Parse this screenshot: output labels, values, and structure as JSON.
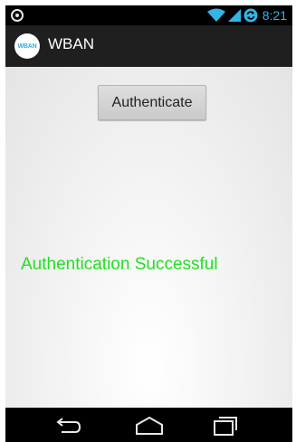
{
  "status_bar": {
    "time": "8:21",
    "icons": [
      "app-notification-icon",
      "wifi-icon",
      "signal-icon",
      "sync-icon"
    ],
    "accent_color": "#33b5e5"
  },
  "action_bar": {
    "logo_text": "WBAN",
    "title": "WBAN"
  },
  "main": {
    "authenticate_label": "Authenticate",
    "status_message": "Authentication Successful",
    "status_color": "#22e022"
  },
  "nav_bar": {
    "icons": [
      "back-icon",
      "home-icon",
      "recent-apps-icon"
    ]
  }
}
